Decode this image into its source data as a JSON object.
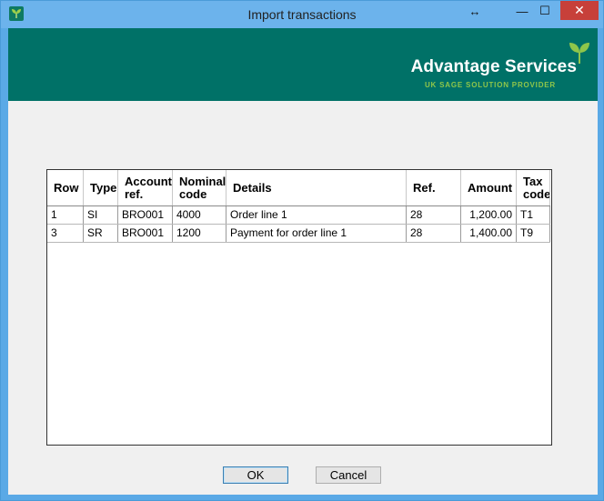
{
  "window": {
    "title": "Import transactions",
    "resize_glyph": "↔",
    "min_glyph": "—",
    "max_glyph": "☐",
    "close_glyph": "✕"
  },
  "banner": {
    "brand": "Advantage Services",
    "tagline": "UK SAGE SOLUTION PROVIDER",
    "color": "#007167",
    "accent": "#8fc64a"
  },
  "grid": {
    "headers": [
      "Row",
      "Type",
      "Account ref.",
      "Nominal code",
      "Details",
      "Ref.",
      "Amount",
      "Tax code"
    ],
    "header_lines": [
      [
        "Row"
      ],
      [
        "Type"
      ],
      [
        "Account",
        "ref."
      ],
      [
        "Nominal",
        "code"
      ],
      [
        "Details"
      ],
      [
        "Ref."
      ],
      [
        "Amount"
      ],
      [
        "Tax",
        "code"
      ]
    ],
    "rows": [
      [
        "1",
        "SI",
        "BRO001",
        "4000",
        "Order line 1",
        "28",
        "1,200.00",
        "T1"
      ],
      [
        "3",
        "SR",
        "BRO001",
        "1200",
        "Payment for order line 1",
        "28",
        "1,400.00",
        "T9"
      ]
    ]
  },
  "buttons": {
    "ok": "OK",
    "cancel": "Cancel"
  }
}
